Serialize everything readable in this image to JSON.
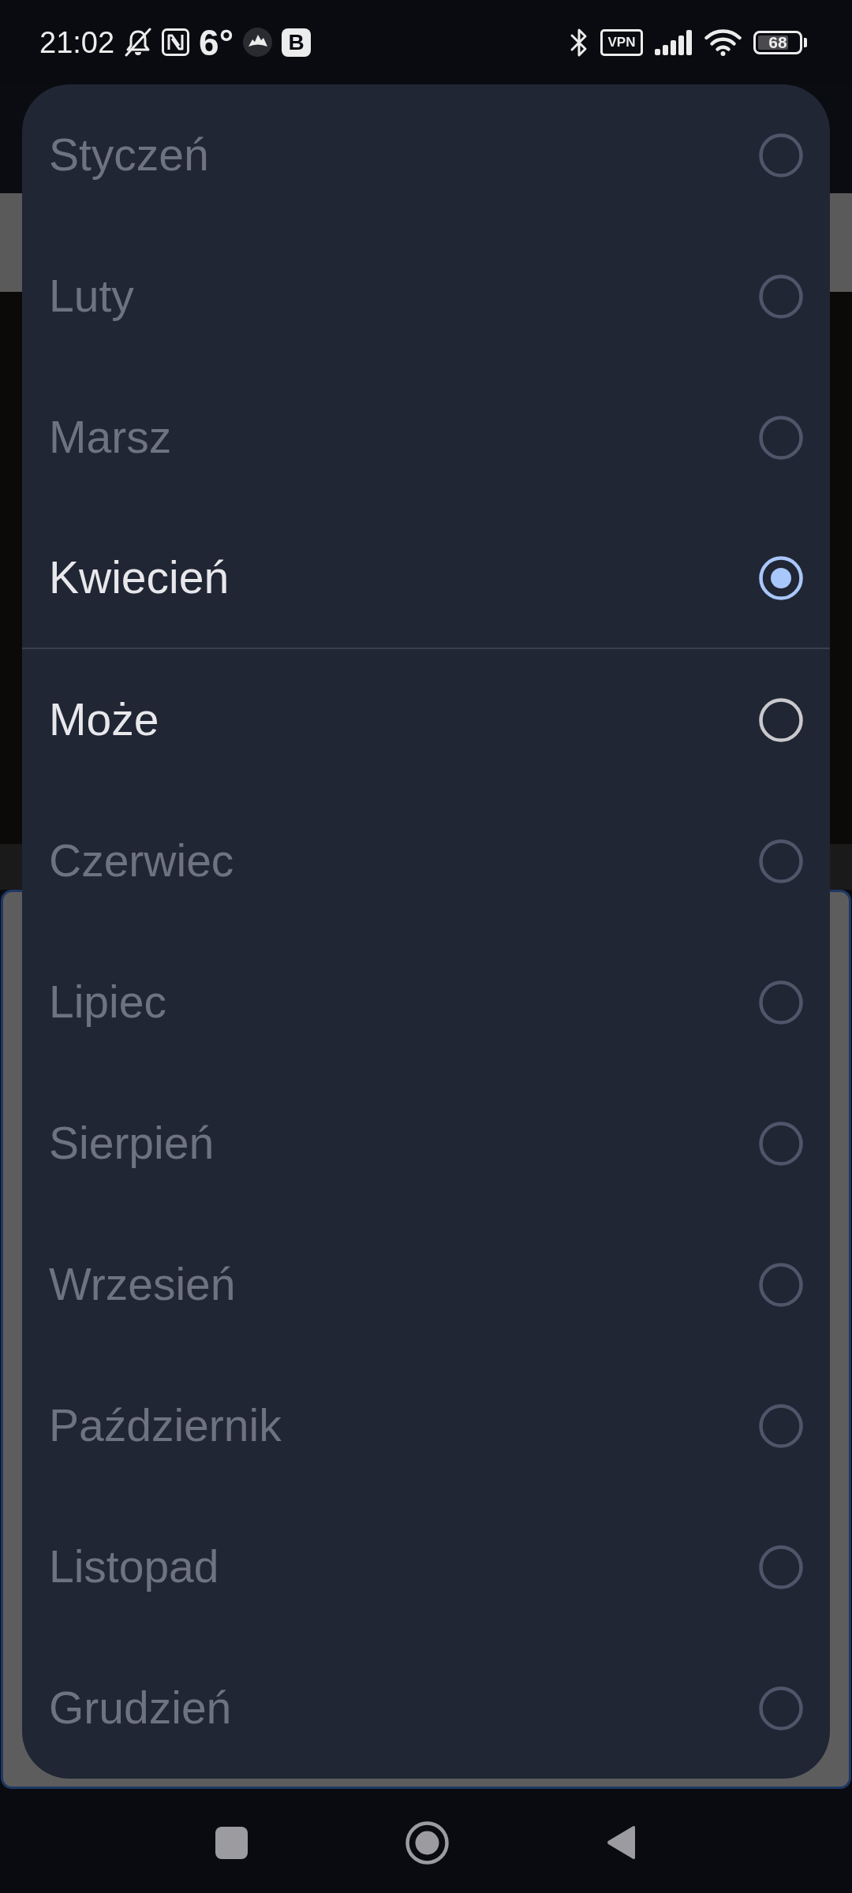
{
  "status_bar": {
    "time": "21:02",
    "temperature": "6°",
    "app_icon_letter": "B",
    "vpn": "VPN",
    "battery": "68"
  },
  "month_picker": {
    "options": [
      {
        "label": "Styczeń",
        "selected": false,
        "disabled": true,
        "divider_below": false
      },
      {
        "label": "Luty",
        "selected": false,
        "disabled": true,
        "divider_below": false
      },
      {
        "label": "Marsz",
        "selected": false,
        "disabled": true,
        "divider_below": false
      },
      {
        "label": "Kwiecień",
        "selected": true,
        "disabled": false,
        "divider_below": true
      },
      {
        "label": "Może",
        "selected": false,
        "disabled": false,
        "divider_below": false
      },
      {
        "label": "Czerwiec",
        "selected": false,
        "disabled": true,
        "divider_below": false
      },
      {
        "label": "Lipiec",
        "selected": false,
        "disabled": true,
        "divider_below": false
      },
      {
        "label": "Sierpień",
        "selected": false,
        "disabled": true,
        "divider_below": false
      },
      {
        "label": "Wrzesień",
        "selected": false,
        "disabled": true,
        "divider_below": false
      },
      {
        "label": "Październik",
        "selected": false,
        "disabled": true,
        "divider_below": false
      },
      {
        "label": "Listopad",
        "selected": false,
        "disabled": true,
        "divider_below": false
      },
      {
        "label": "Grudzień",
        "selected": false,
        "disabled": true,
        "divider_below": false
      }
    ]
  }
}
